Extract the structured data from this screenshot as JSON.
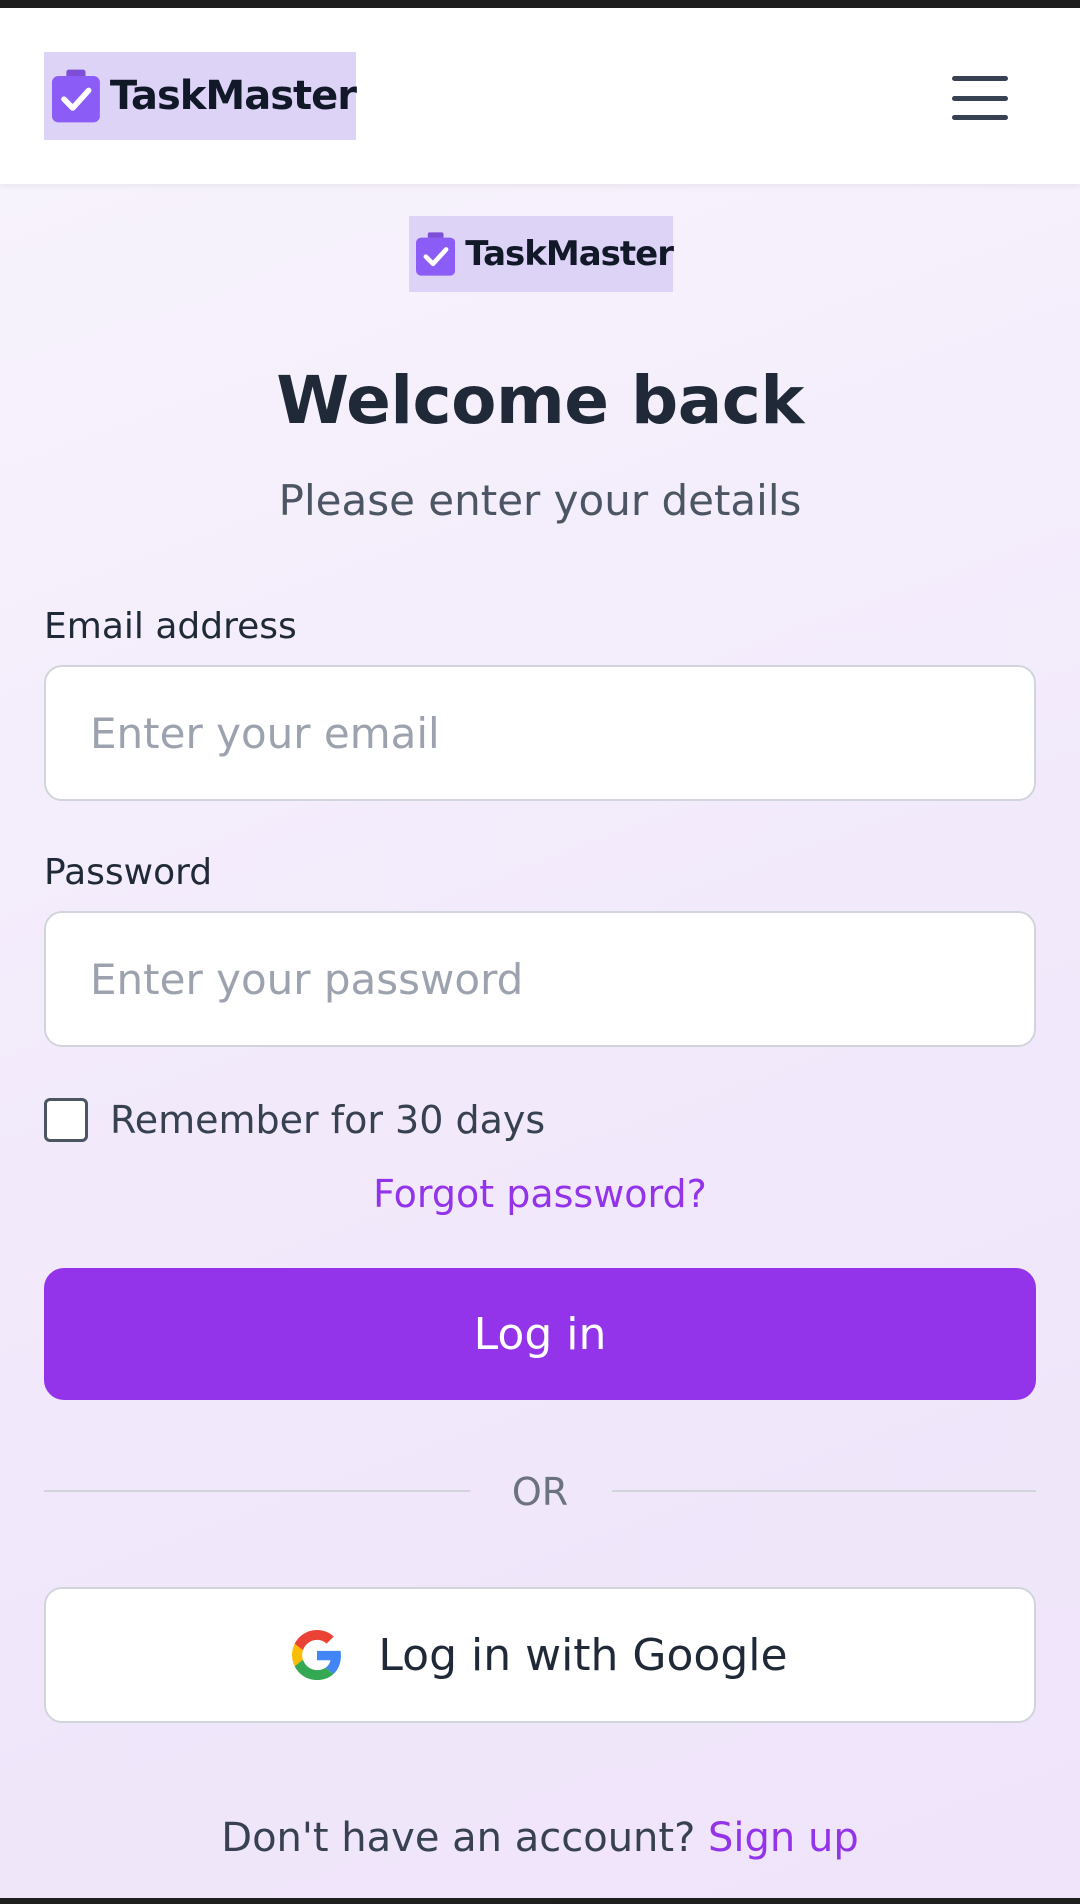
{
  "header": {
    "brand_name": "TaskMaster",
    "menu_icon": "hamburger-menu-icon"
  },
  "form_brand": {
    "brand_name": "TaskMaster"
  },
  "login": {
    "title": "Welcome back",
    "subtitle": "Please enter your details",
    "email_label": "Email address",
    "email_placeholder": "Enter your email",
    "email_value": "",
    "password_label": "Password",
    "password_placeholder": "Enter your password",
    "password_value": "",
    "remember_label": "Remember for 30 days",
    "remember_checked": false,
    "forgot_label": "Forgot password?",
    "login_button_label": "Log in",
    "or_label": "OR",
    "google_button_label": "Log in with Google",
    "signup_prompt": "Don't have an account? ",
    "signup_link_label": "Sign up"
  },
  "icons": {
    "logo": "clipboard-check-icon",
    "google": "google-g-icon"
  },
  "colors": {
    "accent": "#9333ea",
    "logo_purple": "#8b5cf6",
    "brand_highlight": "#ddd3f7",
    "background_tint": "#f3ecfb",
    "text_dark": "#1f2937"
  }
}
